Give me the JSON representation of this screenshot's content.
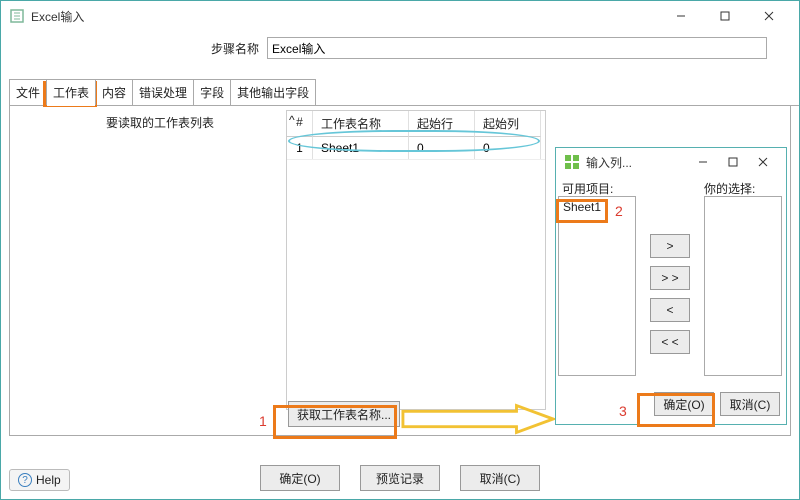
{
  "window": {
    "title": "Excel输入"
  },
  "step": {
    "label": "步骤名称",
    "value": "Excel输入"
  },
  "tabs": [
    "文件",
    "工作表",
    "内容",
    "错误处理",
    "字段",
    "其他输出字段"
  ],
  "active_tab_index": 1,
  "sheet_section": {
    "label": "要读取的工作表列表",
    "columns": {
      "hash": "#",
      "name": "工作表名称",
      "startrow": "起始行",
      "startcol": "起始列"
    },
    "rows": [
      {
        "idx": "1",
        "name": "Sheet1",
        "startrow": "0",
        "startcol": "0"
      }
    ],
    "get_names_button": "获取工作表名称..."
  },
  "footer": {
    "ok": "确定(O)",
    "preview": "预览记录",
    "cancel": "取消(C)",
    "help": "Help"
  },
  "popup": {
    "title": "输入列...",
    "available_label": "可用项目:",
    "selected_label": "你的选择:",
    "available_items": [
      "Sheet1"
    ],
    "selected_items": [],
    "movers": {
      "add": ">",
      "addall": "> >",
      "remove": "<",
      "removeall": "< <"
    },
    "ok": "确定(O)",
    "cancel": "取消(C)"
  },
  "annotations": {
    "step1": "1",
    "step2": "2",
    "step3": "3"
  }
}
